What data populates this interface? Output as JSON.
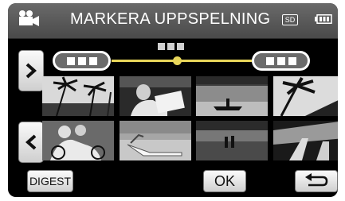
{
  "header": {
    "title": "MARKERA UPPSPELNING",
    "camera_icon": "video-camera-icon",
    "media_badge": "SD",
    "battery_icon": "battery-icon"
  },
  "navigation": {
    "next_icon": "chevron-right-icon",
    "prev_icon": "chevron-left-icon"
  },
  "timeline": {
    "start_icon": "range-start-icon",
    "end_icon": "range-end-icon"
  },
  "thumbnails": [
    {
      "scene": "palm-trees"
    },
    {
      "scene": "person-reading"
    },
    {
      "scene": "rowboat-on-lake"
    },
    {
      "scene": "palm-silhouette"
    },
    {
      "scene": "couple-with-bicycles"
    },
    {
      "scene": "beach-chair"
    },
    {
      "scene": "people-on-beach"
    },
    {
      "scene": "beach-shadows"
    }
  ],
  "footer": {
    "digest_label": "DIGEST",
    "ok_label": "OK",
    "back_icon": "return-icon"
  }
}
